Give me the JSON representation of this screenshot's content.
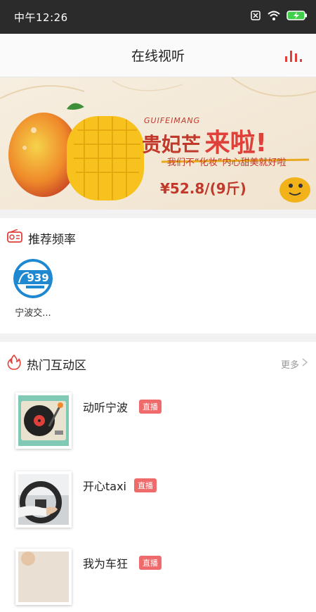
{
  "status_bar": {
    "time": "中午12:26"
  },
  "header": {
    "title": "在线视听"
  },
  "banner": {
    "brand_en": "GUIFEIMANG",
    "headline_part1": "贵妃芒",
    "headline_part2": "来啦!",
    "subline": "我们不“化妆”内心甜美就好啦",
    "price": "¥52.8/(9斤)"
  },
  "recommended": {
    "title": "推荐频率",
    "stations": [
      {
        "logo_text": "939",
        "name": "宁波交..."
      }
    ]
  },
  "hot": {
    "title": "热门互动区",
    "more_label": "更多",
    "items": [
      {
        "name": "动听宁波",
        "badge": "直播"
      },
      {
        "name": "开心taxi",
        "badge": "直播"
      },
      {
        "name": "我为车狂",
        "badge": "直播"
      }
    ]
  },
  "colors": {
    "accent": "#e0403a",
    "badge": "#ef6b6b",
    "divider": "#f2f2f2"
  }
}
